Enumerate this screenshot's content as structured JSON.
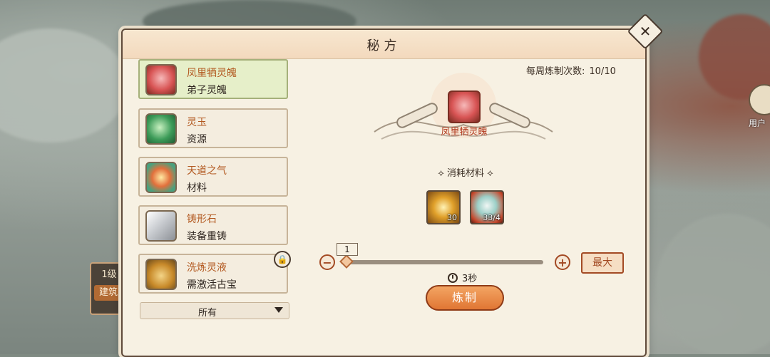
{
  "window": {
    "title": "秘方"
  },
  "header": {
    "weekly_label": "每周炼制次数:",
    "weekly_value": "10/10"
  },
  "recipes": [
    {
      "name": "凤里牺灵魄",
      "category": "弟子灵魄",
      "icon": "phoenix-soul-icon",
      "selected": true
    },
    {
      "name": "灵玉",
      "category": "资源",
      "icon": "jade-icon",
      "selected": false
    },
    {
      "name": "天道之气",
      "category": "材料",
      "icon": "heavenly-qi-icon",
      "selected": false
    },
    {
      "name": "铸形石",
      "category": "装备重铸",
      "icon": "forging-stone-icon",
      "selected": false
    },
    {
      "name": "洗炼灵液",
      "category": "需激活古宝",
      "icon": "refining-liquid-icon",
      "selected": false,
      "locked": true
    }
  ],
  "filter": {
    "value": "所有"
  },
  "product": {
    "name": "凤里牺灵魄",
    "icon": "phoenix-soul-icon"
  },
  "materials": {
    "title": "消耗材料",
    "items": [
      {
        "icon": "yin-yang-orb-icon",
        "count": "30"
      },
      {
        "icon": "crystal-flame-icon",
        "count": "33/4"
      }
    ]
  },
  "quantity": {
    "value": "1",
    "min": 1,
    "max": 10,
    "progress": 0.0
  },
  "max_button": {
    "label": "最大"
  },
  "time": {
    "value": "3秒"
  },
  "craft_button": {
    "label": "炼制"
  },
  "background": {
    "left_level": "1级",
    "left_build": "建筑",
    "user_label": "用户"
  },
  "colors": {
    "accent": "#e07634",
    "name_color": "#b2581f",
    "selected_bg": "#e6efc9"
  }
}
